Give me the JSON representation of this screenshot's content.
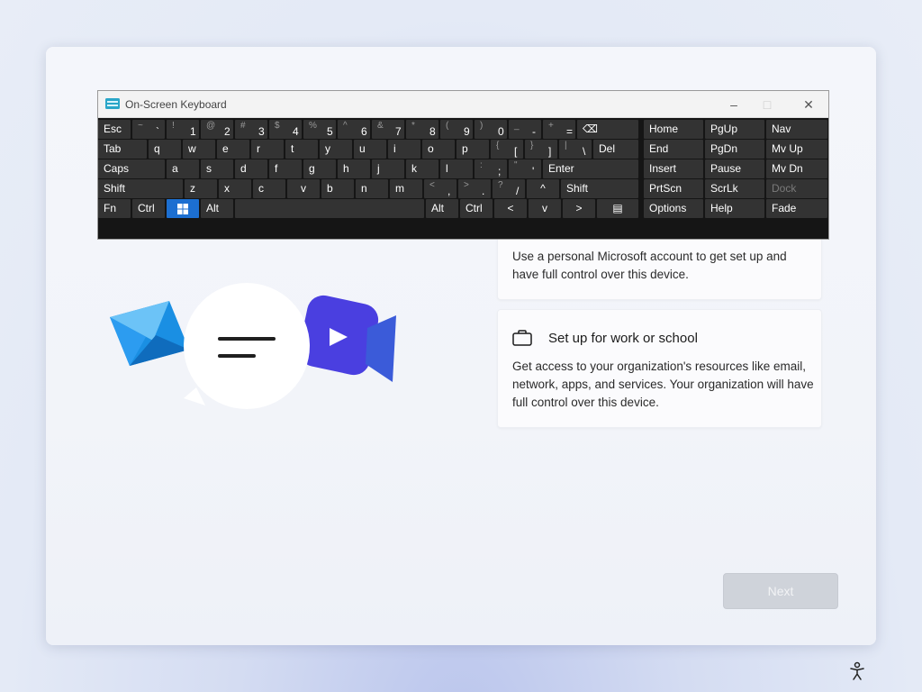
{
  "osk": {
    "title": "On-Screen Keyboard",
    "minimize": "–",
    "maximize": "□",
    "close": "✕",
    "row1": [
      {
        "lbl": "Esc"
      },
      {
        "sup": "~",
        "sub": "`"
      },
      {
        "sup": "!",
        "sub": "1"
      },
      {
        "sup": "@",
        "sub": "2"
      },
      {
        "sup": "#",
        "sub": "3"
      },
      {
        "sup": "$",
        "sub": "4"
      },
      {
        "sup": "%",
        "sub": "5"
      },
      {
        "sup": "^",
        "sub": "6"
      },
      {
        "sup": "&",
        "sub": "7"
      },
      {
        "sup": "*",
        "sub": "8"
      },
      {
        "sup": "(",
        "sub": "9"
      },
      {
        "sup": ")",
        "sub": "0"
      },
      {
        "sup": "_",
        "sub": "-"
      },
      {
        "sup": "+",
        "sub": "="
      },
      {
        "lbl": "⌫"
      }
    ],
    "row2": [
      {
        "lbl": "Tab"
      },
      {
        "lbl": "q"
      },
      {
        "lbl": "w"
      },
      {
        "lbl": "e"
      },
      {
        "lbl": "r"
      },
      {
        "lbl": "t"
      },
      {
        "lbl": "y"
      },
      {
        "lbl": "u"
      },
      {
        "lbl": "i"
      },
      {
        "lbl": "o"
      },
      {
        "lbl": "p"
      },
      {
        "sup": "{",
        "sub": "["
      },
      {
        "sup": "}",
        "sub": "]"
      },
      {
        "sup": "|",
        "sub": "\\"
      },
      {
        "lbl": "Del"
      }
    ],
    "row3": [
      {
        "lbl": "Caps"
      },
      {
        "lbl": "a"
      },
      {
        "lbl": "s"
      },
      {
        "lbl": "d"
      },
      {
        "lbl": "f"
      },
      {
        "lbl": "g"
      },
      {
        "lbl": "h"
      },
      {
        "lbl": "j"
      },
      {
        "lbl": "k"
      },
      {
        "lbl": "l"
      },
      {
        "sup": ":",
        "sub": ";"
      },
      {
        "sup": "\"",
        "sub": "'"
      },
      {
        "lbl": "Enter"
      }
    ],
    "row4": [
      {
        "lbl": "Shift"
      },
      {
        "lbl": "z"
      },
      {
        "lbl": "x"
      },
      {
        "lbl": "c"
      },
      {
        "lbl": "v"
      },
      {
        "lbl": "b"
      },
      {
        "lbl": "n"
      },
      {
        "lbl": "m"
      },
      {
        "sup": "<",
        "sub": ","
      },
      {
        "sup": ">",
        "sub": "."
      },
      {
        "sup": "?",
        "sub": "/"
      },
      {
        "lbl": "^"
      },
      {
        "lbl": "Shift"
      }
    ],
    "row5": [
      {
        "lbl": "Fn"
      },
      {
        "lbl": "Ctrl"
      },
      {
        "lbl": ""
      },
      {
        "lbl": "Alt"
      },
      {
        "lbl": ""
      },
      {
        "lbl": "Alt"
      },
      {
        "lbl": "Ctrl"
      },
      {
        "lbl": "<"
      },
      {
        "lbl": "v"
      },
      {
        "lbl": ">"
      },
      {
        "lbl": "▤"
      }
    ],
    "nav": [
      [
        "Home",
        "PgUp",
        "Nav"
      ],
      [
        "End",
        "PgDn",
        "Mv Up"
      ],
      [
        "Insert",
        "Pause",
        "Mv Dn"
      ],
      [
        "PrtScn",
        "ScrLk",
        "Dock"
      ],
      [
        "Options",
        "Help",
        "Fade"
      ]
    ]
  },
  "personal": {
    "description": "Use a personal Microsoft account to get set up and have full control over this device."
  },
  "work": {
    "title": "Set up for work or school",
    "description": "Get access to your organization's resources like email, network, apps, and services. Your organization will have full control over this device."
  },
  "next_label": "Next"
}
